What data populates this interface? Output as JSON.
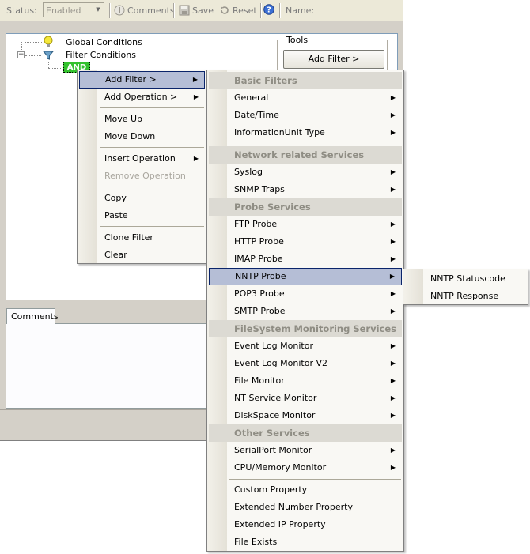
{
  "toolbar": {
    "status_label": "Status:",
    "status_value": "Enabled",
    "comments_label": "Comments",
    "save_label": "Save",
    "reset_label": "Reset",
    "name_label": "Name:"
  },
  "tree": {
    "global_conditions": "Global Conditions",
    "filter_conditions": "Filter Conditions",
    "and_operator": "AND"
  },
  "tools": {
    "group_label": "Tools",
    "add_filter_button": "Add Filter >"
  },
  "comments_tab": "Comments",
  "context_menu": {
    "items": [
      {
        "label": "Add Filter >",
        "submenu": true,
        "highlighted": true
      },
      {
        "label": "Add Operation >",
        "submenu": true
      },
      {
        "label": "Move Up"
      },
      {
        "label": "Move Down"
      },
      {
        "label": "Insert Operation",
        "submenu": true
      },
      {
        "label": "Remove Operation",
        "disabled": true
      },
      {
        "label": "Copy"
      },
      {
        "label": "Paste"
      },
      {
        "label": "Clone Filter"
      },
      {
        "label": "Clear"
      }
    ]
  },
  "filter_menu": {
    "basic_header": "Basic Filters",
    "general": "General",
    "datetime": "Date/Time",
    "infounit": "InformationUnit Type",
    "network_header": "Network related Services",
    "syslog": "Syslog",
    "snmp": "SNMP Traps",
    "probe_header": "Probe Services",
    "ftp": "FTP Probe",
    "http": "HTTP Probe",
    "imap": "IMAP Probe",
    "nntp": "NNTP Probe",
    "pop3": "POP3 Probe",
    "smtp": "SMTP Probe",
    "fs_header": "FileSystem Monitoring Services",
    "eventlog": "Event Log Monitor",
    "eventlog2": "Event Log Monitor V2",
    "filemon": "File Monitor",
    "ntservice": "NT Service Monitor",
    "diskspace": "DiskSpace Monitor",
    "other_header": "Other Services",
    "serialport": "SerialPort Monitor",
    "cpumem": "CPU/Memory Monitor",
    "custom": "Custom Property",
    "extnum": "Extended Number Property",
    "extip": "Extended IP Property",
    "fileexists": "File Exists"
  },
  "nntp_submenu": {
    "statuscode": "NNTP Statuscode",
    "response": "NNTP Response"
  }
}
